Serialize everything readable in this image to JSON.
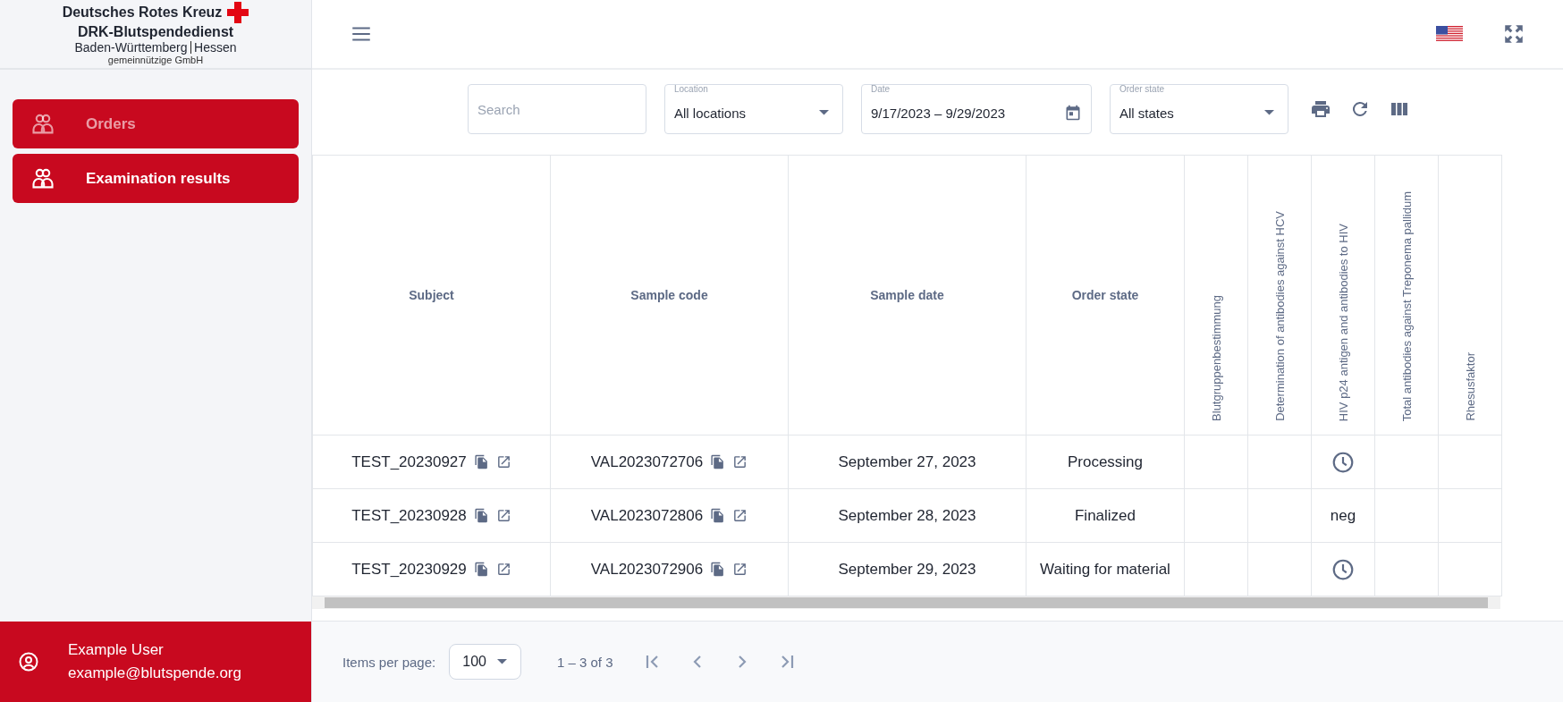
{
  "logo": {
    "line_1": "Deutsches Rotes Kreuz",
    "line_2": "DRK-Blutspendedienst",
    "line_3": "Baden-Württemberg",
    "line_3b": "Hessen",
    "line_4": "gemeinnützige GmbH"
  },
  "sidebar": {
    "items": [
      {
        "label": "Orders",
        "selected": false
      },
      {
        "label": "Examination results",
        "selected": true
      }
    ]
  },
  "user": {
    "name": "Example User",
    "email": "example@blutspende.org"
  },
  "filters": {
    "search": {
      "placeholder": "Search"
    },
    "location": {
      "label": "Location",
      "value": "All locations"
    },
    "date": {
      "label": "Date",
      "value": "9/17/2023 – 9/29/2023"
    },
    "order_state": {
      "label": "Order state",
      "value": "All states"
    }
  },
  "table": {
    "columns": [
      "Subject",
      "Sample code",
      "Sample date",
      "Order state"
    ],
    "result_columns": [
      "Blutgruppenbestimmung",
      "Determination of antibodies against HCV",
      "HIV p24 antigen and antibodies to HIV",
      "Total antibodies against Treponema pallidum",
      "Rhesusfaktor"
    ],
    "rows": [
      {
        "subject": "TEST_20230927",
        "sample_code": "VAL2023072706",
        "sample_date": "September 27, 2023",
        "order_state": "Processing",
        "results": [
          {
            "kind": "empty"
          },
          {
            "kind": "empty"
          },
          {
            "kind": "pending"
          },
          {
            "kind": "empty"
          },
          {
            "kind": "empty"
          }
        ]
      },
      {
        "subject": "TEST_20230928",
        "sample_code": "VAL2023072806",
        "sample_date": "September 28, 2023",
        "order_state": "Finalized",
        "results": [
          {
            "kind": "empty"
          },
          {
            "kind": "empty"
          },
          {
            "kind": "text",
            "text": "neg"
          },
          {
            "kind": "empty"
          },
          {
            "kind": "empty"
          }
        ]
      },
      {
        "subject": "TEST_20230929",
        "sample_code": "VAL2023072906",
        "sample_date": "September 29, 2023",
        "order_state": "Waiting for material",
        "results": [
          {
            "kind": "empty"
          },
          {
            "kind": "empty"
          },
          {
            "kind": "pending"
          },
          {
            "kind": "empty"
          },
          {
            "kind": "empty"
          }
        ]
      }
    ]
  },
  "paginator": {
    "label": "Items per page:",
    "page_size": "100",
    "range": "1 – 3 of 3"
  }
}
